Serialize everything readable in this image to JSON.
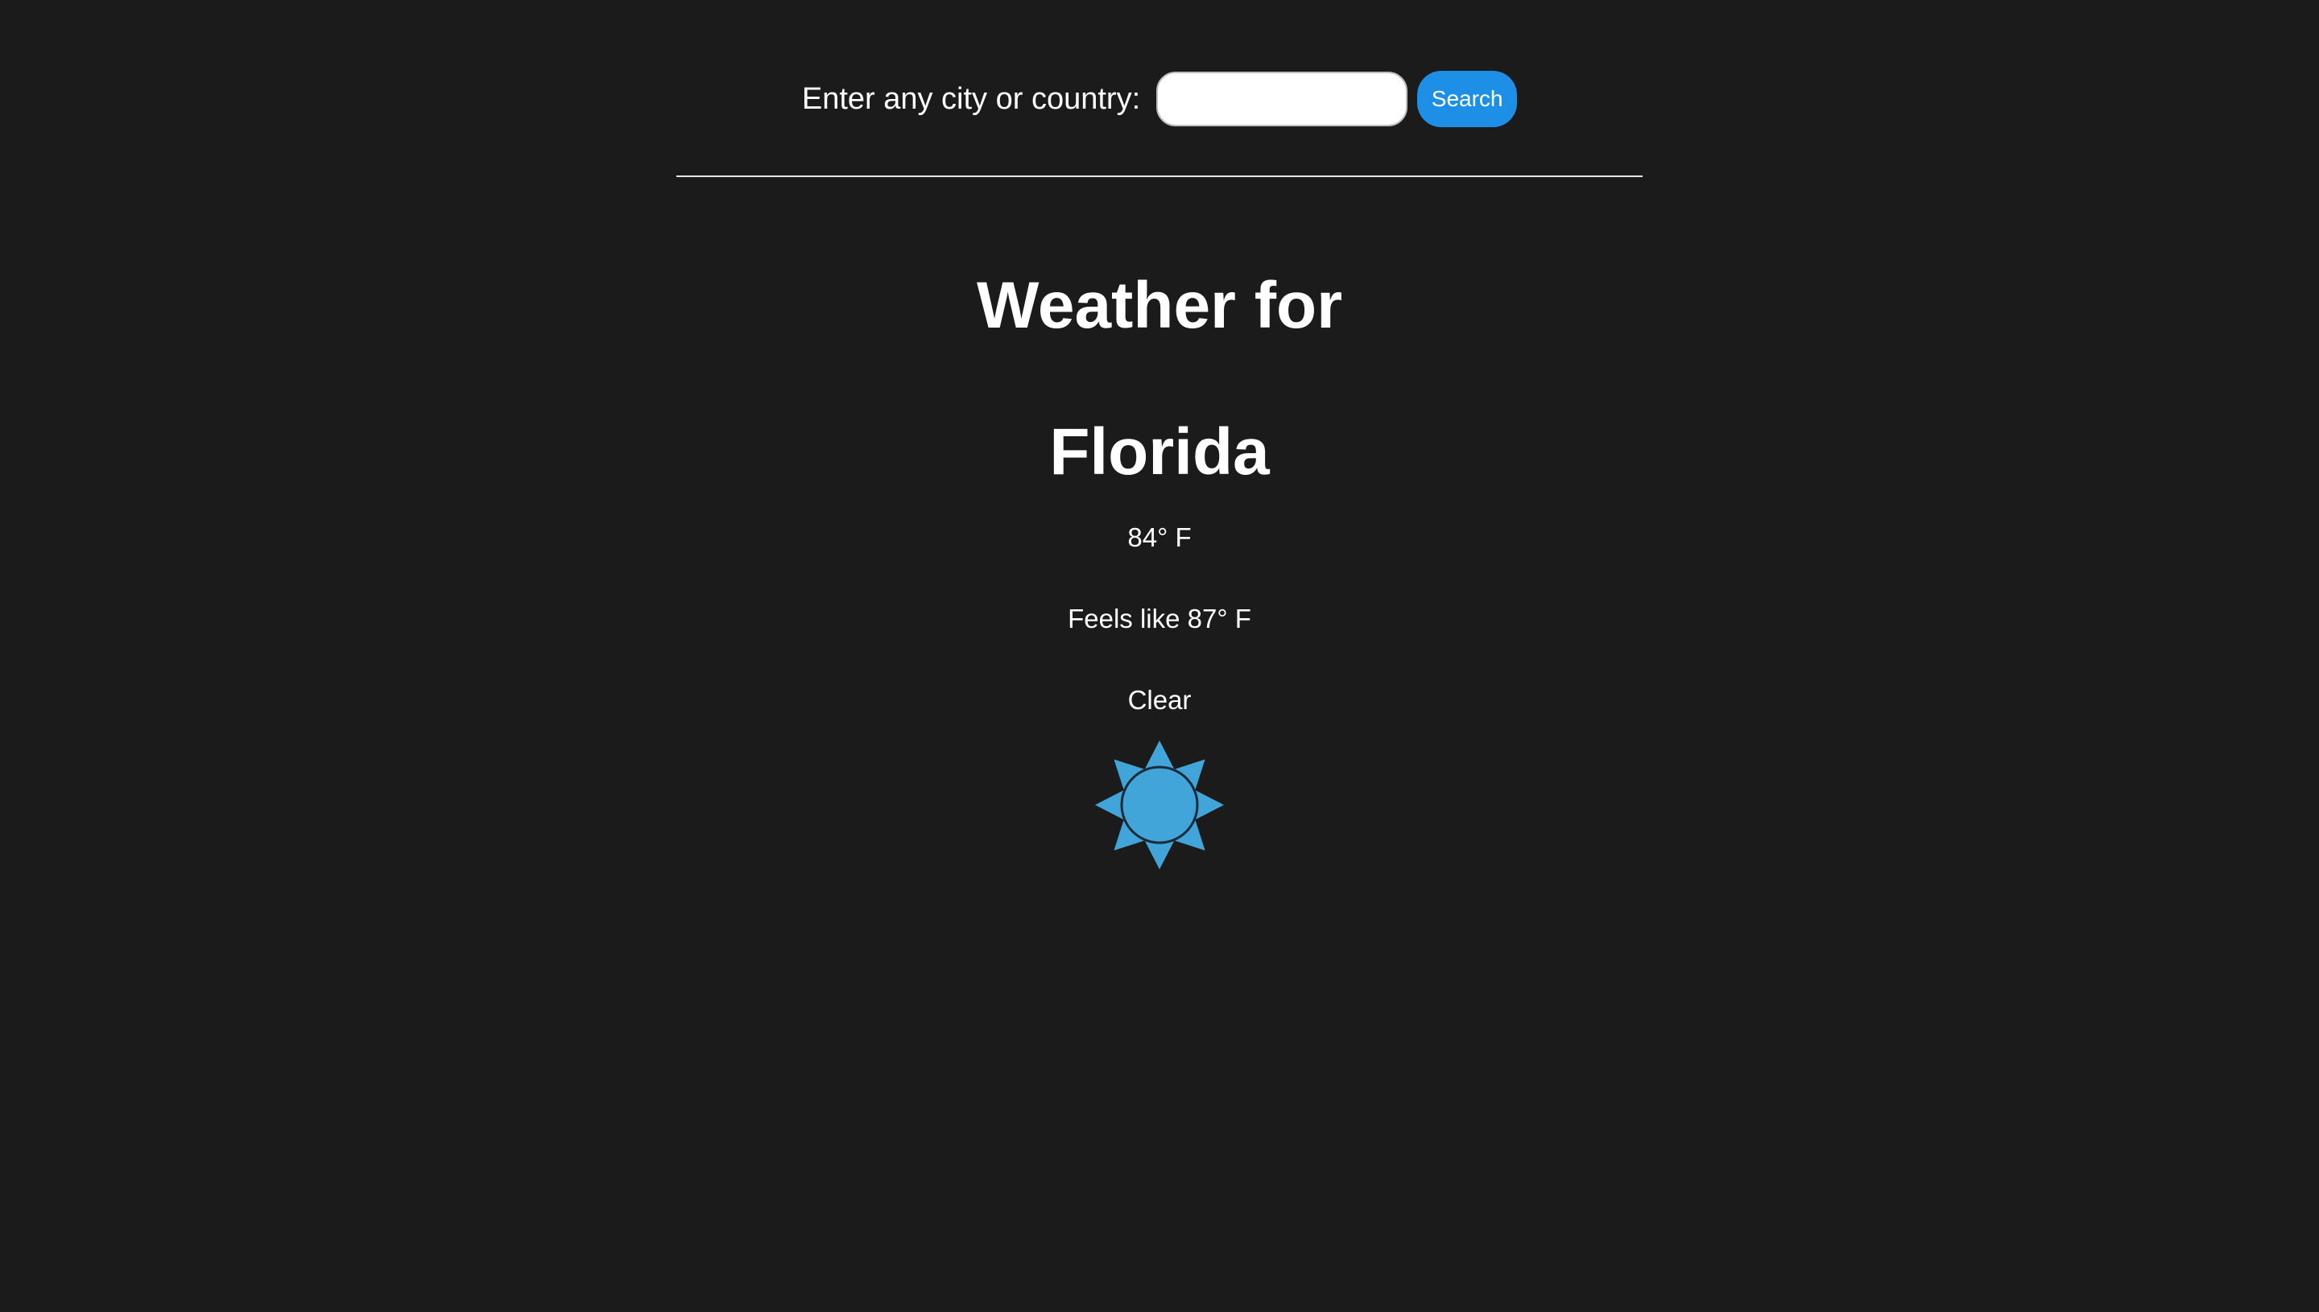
{
  "search": {
    "label": "Enter any city or country:",
    "input_value": "",
    "placeholder": "",
    "button_label": "Search"
  },
  "weather": {
    "heading_prefix": "Weather for",
    "location": "Florida",
    "temperature": "84° F",
    "feels_like": "Feels like 87° F",
    "condition": "Clear",
    "icon": "sun-icon"
  },
  "colors": {
    "background": "#1b1b1b",
    "text": "#ffffff",
    "button": "#1e8fe6",
    "sun": "#42a5d9",
    "sun_outline": "#1a2a38"
  }
}
